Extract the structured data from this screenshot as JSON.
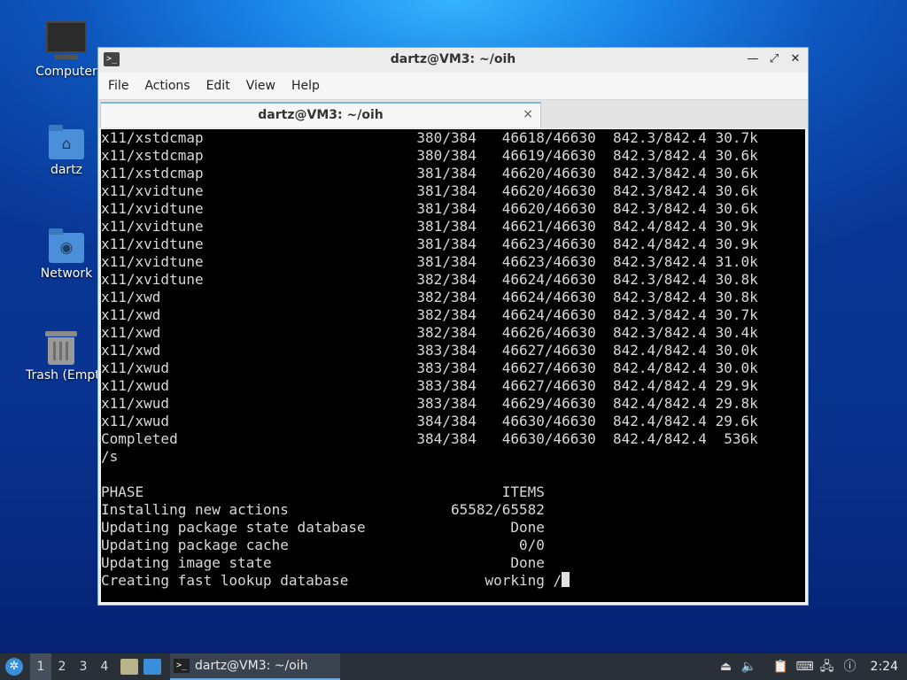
{
  "desktop": {
    "icons": [
      {
        "label": "Computer"
      },
      {
        "label": "dartz"
      },
      {
        "label": "Network"
      },
      {
        "label": "Trash (Empty)"
      }
    ]
  },
  "window": {
    "title": "dartz@VM3: ~/oih",
    "menu": [
      "File",
      "Actions",
      "Edit",
      "View",
      "Help"
    ],
    "tab_title": "dartz@VM3: ~/oih",
    "close_glyph": "×"
  },
  "terminal": {
    "lines": [
      "x11/xstdcmap                         380/384   46618/46630  842.3/842.4 30.7k",
      "x11/xstdcmap                         380/384   46619/46630  842.3/842.4 30.6k",
      "x11/xstdcmap                         381/384   46620/46630  842.3/842.4 30.6k",
      "x11/xvidtune                         381/384   46620/46630  842.3/842.4 30.6k",
      "x11/xvidtune                         381/384   46620/46630  842.3/842.4 30.6k",
      "x11/xvidtune                         381/384   46621/46630  842.4/842.4 30.9k",
      "x11/xvidtune                         381/384   46623/46630  842.4/842.4 30.9k",
      "x11/xvidtune                         381/384   46623/46630  842.3/842.4 31.0k",
      "x11/xvidtune                         382/384   46624/46630  842.3/842.4 30.8k",
      "x11/xwd                              382/384   46624/46630  842.3/842.4 30.8k",
      "x11/xwd                              382/384   46624/46630  842.3/842.4 30.7k",
      "x11/xwd                              382/384   46626/46630  842.3/842.4 30.4k",
      "x11/xwd                              383/384   46627/46630  842.4/842.4 30.0k",
      "x11/xwud                             383/384   46627/46630  842.4/842.4 30.0k",
      "x11/xwud                             383/384   46627/46630  842.4/842.4 29.9k",
      "x11/xwud                             383/384   46629/46630  842.4/842.4 29.8k",
      "x11/xwud                             384/384   46630/46630  842.4/842.4 29.6k",
      "Completed                            384/384   46630/46630  842.4/842.4  536k",
      "/s",
      "",
      "PHASE                                          ITEMS",
      "Installing new actions                   65582/65582",
      "Updating package state database                 Done",
      "Updating package cache                           0/0",
      "Updating image state                            Done",
      "Creating fast lookup database                working /"
    ]
  },
  "taskbar": {
    "workspaces": [
      "1",
      "2",
      "3",
      "4"
    ],
    "active_workspace": "1",
    "task_label": "dartz@VM3: ~/oih",
    "clock": "2:24"
  }
}
